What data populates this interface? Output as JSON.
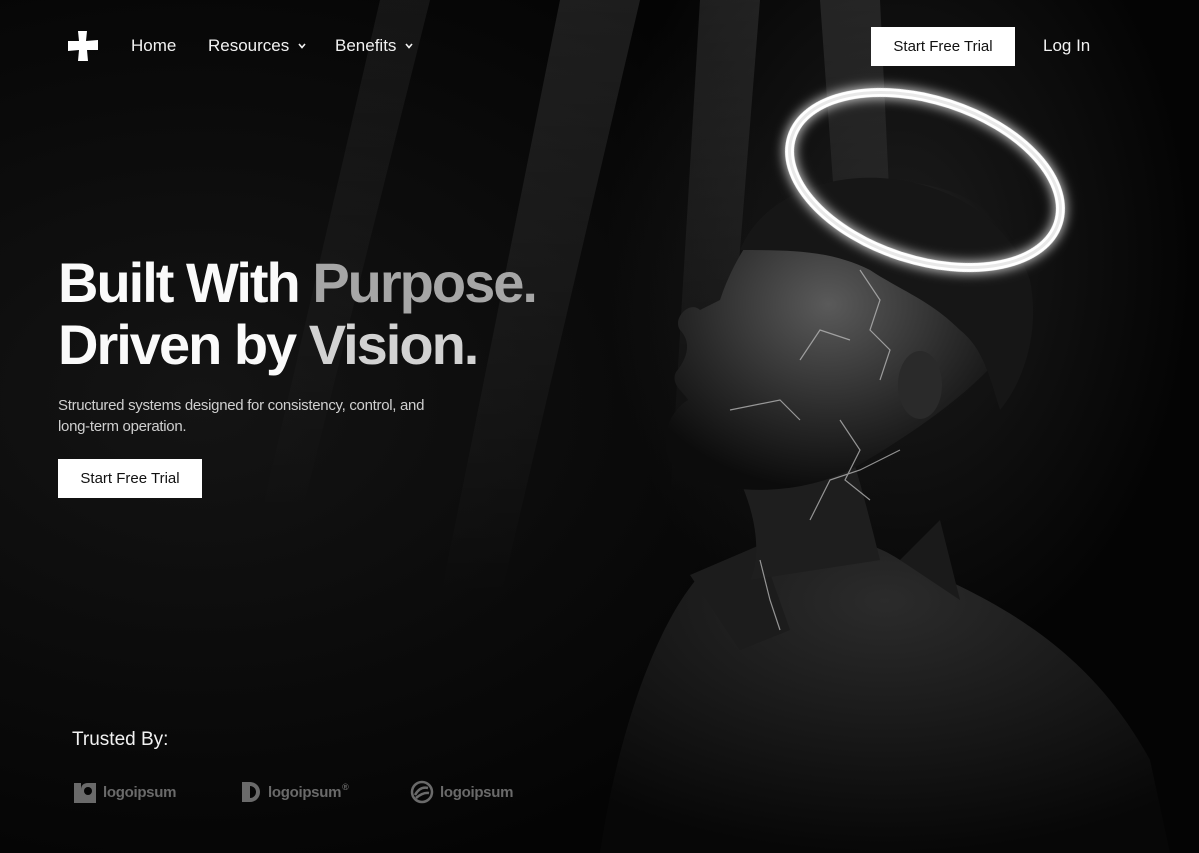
{
  "nav": {
    "links": [
      {
        "label": "Home",
        "has_dropdown": false
      },
      {
        "label": "Resources",
        "has_dropdown": true
      },
      {
        "label": "Benefits",
        "has_dropdown": true
      }
    ],
    "cta_label": "Start Free Trial",
    "login_label": "Log In"
  },
  "hero": {
    "line1_a": "Built With",
    "line1_b": "Purpose.",
    "line2_a": "Driven by",
    "line2_b": "Vision.",
    "subtitle": "Structured systems designed for consistency, control, and long-term operation.",
    "cta_label": "Start Free Trial"
  },
  "trusted": {
    "label": "Trusted By:",
    "logos": [
      {
        "name": "logoipsum",
        "icon": "square-logo-icon"
      },
      {
        "name": "logoipsum",
        "icon": "half-circle-logo-icon",
        "mark": "®"
      },
      {
        "name": "logoipsum",
        "icon": "circle-stripe-logo-icon"
      }
    ]
  },
  "colors": {
    "background": "#050505",
    "button_bg": "#ffffff",
    "headline_white": "#fafafa",
    "headline_gray": "#a6a6a6",
    "logo_gray": "#6a6a6a"
  }
}
